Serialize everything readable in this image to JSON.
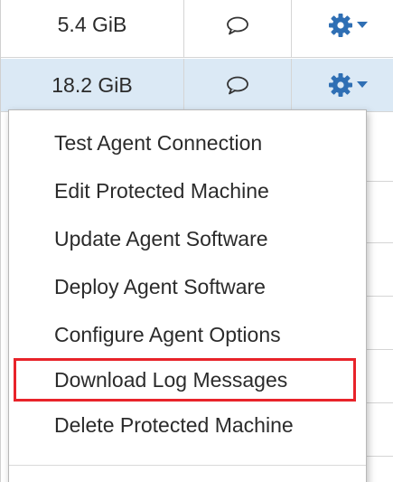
{
  "rows": [
    {
      "size": "5.4 GiB",
      "comment_icon": "comment-icon",
      "actions_icon": "gear-icon"
    },
    {
      "size": "18.2 GiB",
      "comment_icon": "comment-icon",
      "actions_icon": "gear-icon"
    }
  ],
  "menu": {
    "items": [
      {
        "label": "Test Agent Connection",
        "highlighted": false
      },
      {
        "label": "Edit Protected Machine",
        "highlighted": false
      },
      {
        "label": "Update Agent Software",
        "highlighted": false
      },
      {
        "label": "Deploy Agent Software",
        "highlighted": false
      },
      {
        "label": "Configure Agent Options",
        "highlighted": false
      },
      {
        "label": "Download Log Messages",
        "highlighted": true
      },
      {
        "label": "Delete Protected Machine",
        "highlighted": false
      }
    ]
  },
  "colors": {
    "selected_row": "#dbe9f5",
    "gear": "#2f6fb4",
    "highlight_border": "#e8232a",
    "text": "#2b2b2b"
  }
}
